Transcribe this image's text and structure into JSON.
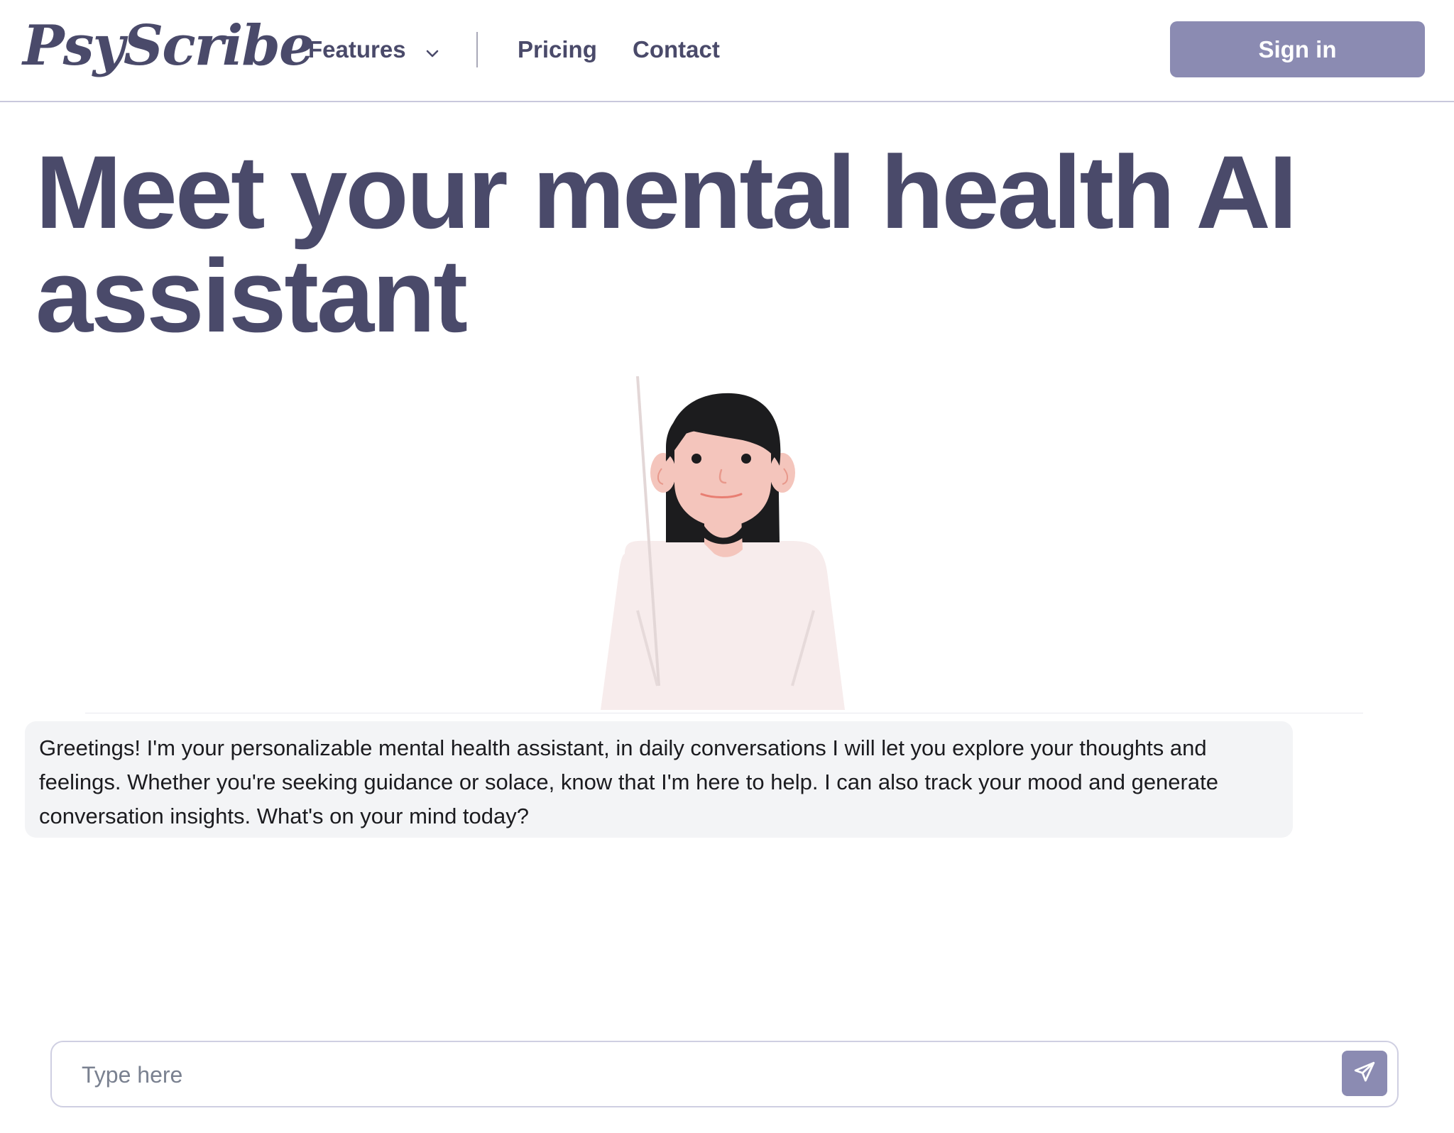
{
  "header": {
    "logo_text": "PsyScribe",
    "nav": {
      "features_label": "Features",
      "features_icon": "chevron-down-icon",
      "pricing_label": "Pricing",
      "contact_label": "Contact"
    },
    "signin_label": "Sign in"
  },
  "hero": {
    "title": "Meet your mental health AI assistant",
    "avatar_icon": "assistant-avatar-illustration"
  },
  "chat": {
    "messages": [
      {
        "role": "assistant",
        "text": "Greetings! I'm your personalizable mental health assistant, in daily conversations I will let you explore your thoughts and feelings. Whether you're seeking guidance or solace, know that I'm here to help. I can also track your mood and generate conversation insights. What's on your mind today?"
      }
    ],
    "input_value": "",
    "input_placeholder": "Type here",
    "send_icon": "send-icon"
  },
  "colors": {
    "primary_text": "#4a4a6a",
    "accent": "#8b8bb2",
    "message_bg": "#f3f4f6",
    "border": "#cfcfe2"
  }
}
